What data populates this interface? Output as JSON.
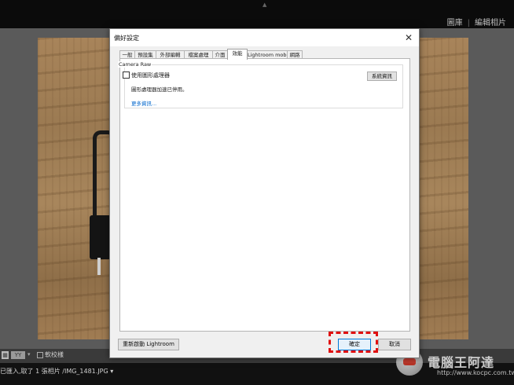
{
  "lightroom": {
    "modules": [
      "圖庫",
      "編輯相片"
    ],
    "toolbar": {
      "view_mode_label": "YY",
      "soft_proofing_label": "軟校樣"
    },
    "status_text": "已匯入,取了 1 張相片 /IMG_1481.JPG ▾"
  },
  "dialog": {
    "title": "偏好設定",
    "tabs": [
      {
        "label": "一般",
        "active": false
      },
      {
        "label": "預設集",
        "active": false
      },
      {
        "label": "外部編輯",
        "active": false
      },
      {
        "label": "檔案處理",
        "active": false
      },
      {
        "label": "介面",
        "active": false
      },
      {
        "label": "效能",
        "active": true
      },
      {
        "label": "Lightroom mobile",
        "active": false
      },
      {
        "label": "網路",
        "active": false
      }
    ],
    "camera_raw": {
      "group_title": "Camera Raw",
      "use_gpu_label": "使用圖形處理器",
      "use_gpu_checked": false,
      "system_info_button": "系統資訊",
      "gpu_status": "圖形處理器加速已停用。",
      "more_info_link": "更多資訊..."
    },
    "buttons": {
      "restart": "重新啟動 Lightroom",
      "ok": "確定",
      "cancel": "取消"
    }
  },
  "watermark": {
    "title": "電腦王阿達",
    "url": "http://www.kocpc.com.tw"
  }
}
